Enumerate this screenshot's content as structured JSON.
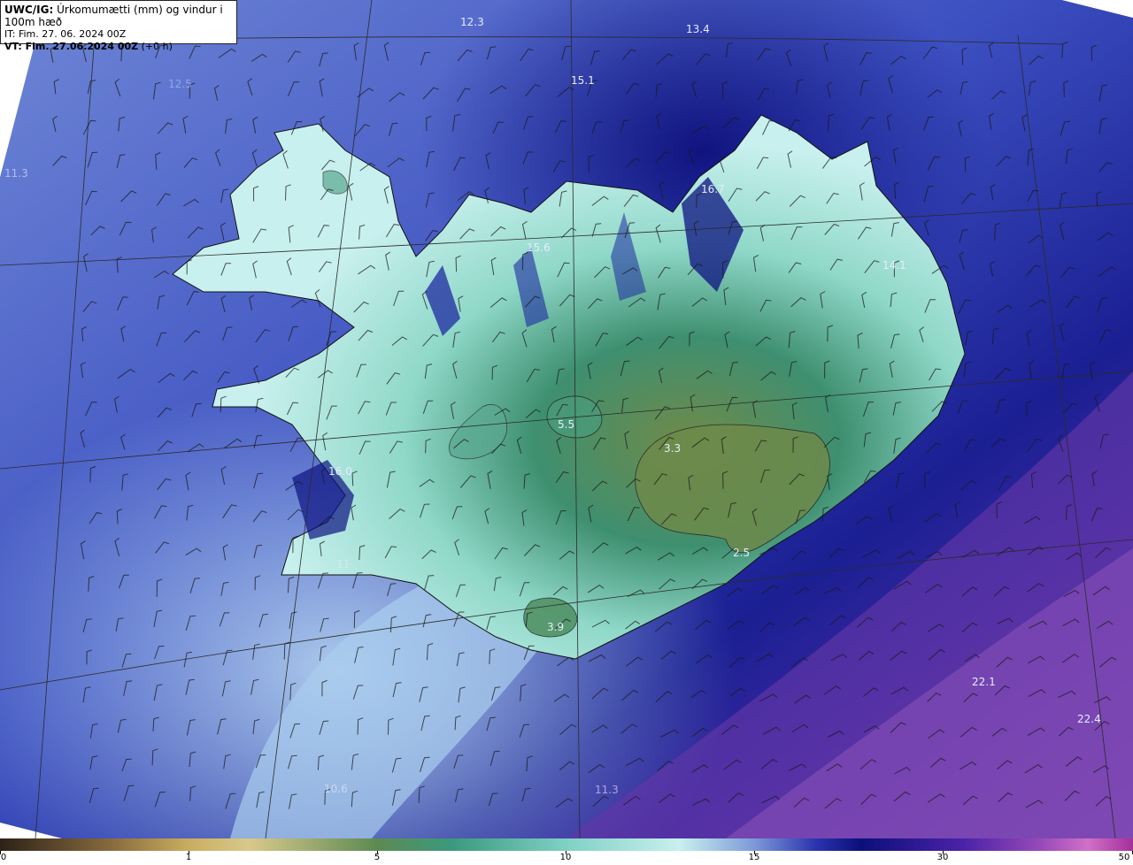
{
  "info": {
    "title_bold": "UWC/IG:",
    "title_rest": " Úrkomumætti (mm) og vindur i 100m hæð",
    "it_line": "IT: Fim. 27. 06. 2024 00Z",
    "vt_bold": "VT: Fim. 27.06.2024 00Z",
    "vt_rest": " (+0 h)"
  },
  "field_values": [
    "12.3",
    "13.4",
    "15.1",
    "11.3",
    "16.7",
    "15.6",
    "14.1",
    "5.5",
    "3.3",
    "16.0",
    "2.5",
    "3.9",
    "22.1",
    "22.4",
    "10.6",
    "11.3",
    "11",
    "12.5"
  ],
  "colorbar": {
    "labels": [
      "0",
      "1",
      "5",
      "10",
      "15",
      "30",
      "50"
    ],
    "colors": [
      "#2d2218",
      "#c9ad5f",
      "#5d8a52",
      "#7fd1c4",
      "#0c0f7a",
      "#9a4ab8",
      "#a4309a"
    ]
  },
  "colors": {
    "land_high": "#6d8a4a",
    "land_mid": "#3f9a7c",
    "ocean_light": "#9fc4ea",
    "ocean_mid": "#4a62c8",
    "ocean_dark": "#0d1280",
    "ocean_purple": "#6a3aa8",
    "grid": "#2a2a2a",
    "barb": "#1a1a1a"
  }
}
